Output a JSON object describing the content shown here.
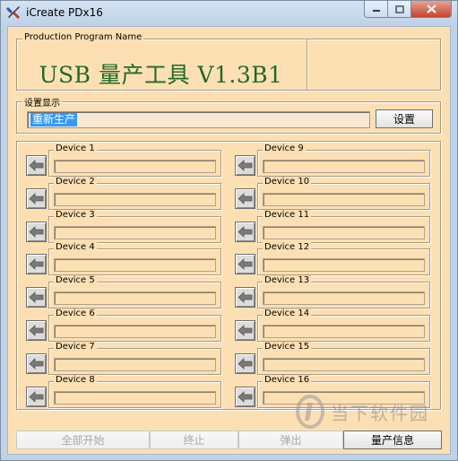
{
  "window": {
    "title": "iCreate PDx16"
  },
  "program_group": {
    "label": "Production Program Name",
    "program_name": "USB 量产工具 V1.3B1"
  },
  "settings_group": {
    "label": "设置显示",
    "input_value": "重新生产",
    "set_button": "设置"
  },
  "devices_left": [
    {
      "label": "Device 1"
    },
    {
      "label": "Device 2"
    },
    {
      "label": "Device 3"
    },
    {
      "label": "Device 4"
    },
    {
      "label": "Device 5"
    },
    {
      "label": "Device 6"
    },
    {
      "label": "Device 7"
    },
    {
      "label": "Device 8"
    }
  ],
  "devices_right": [
    {
      "label": "Device 9"
    },
    {
      "label": "Device 10"
    },
    {
      "label": "Device 11"
    },
    {
      "label": "Device 12"
    },
    {
      "label": "Device 13"
    },
    {
      "label": "Device 14"
    },
    {
      "label": "Device 15"
    },
    {
      "label": "Device 16"
    }
  ],
  "bottom_buttons": {
    "start_all": "全部开始",
    "stop": "终止",
    "eject": "弹出",
    "production_info": "量产信息"
  },
  "watermark": {
    "text": "当下软件园"
  },
  "icons": {
    "app": "tools-icon",
    "device_arrow": "left-arrow-icon",
    "minimize": "minimize-icon",
    "maximize": "maximize-icon",
    "close": "close-icon"
  },
  "colors": {
    "client_bg": "#fce0b4",
    "program_title": "#1f6a26",
    "selection": "#3399ff"
  }
}
